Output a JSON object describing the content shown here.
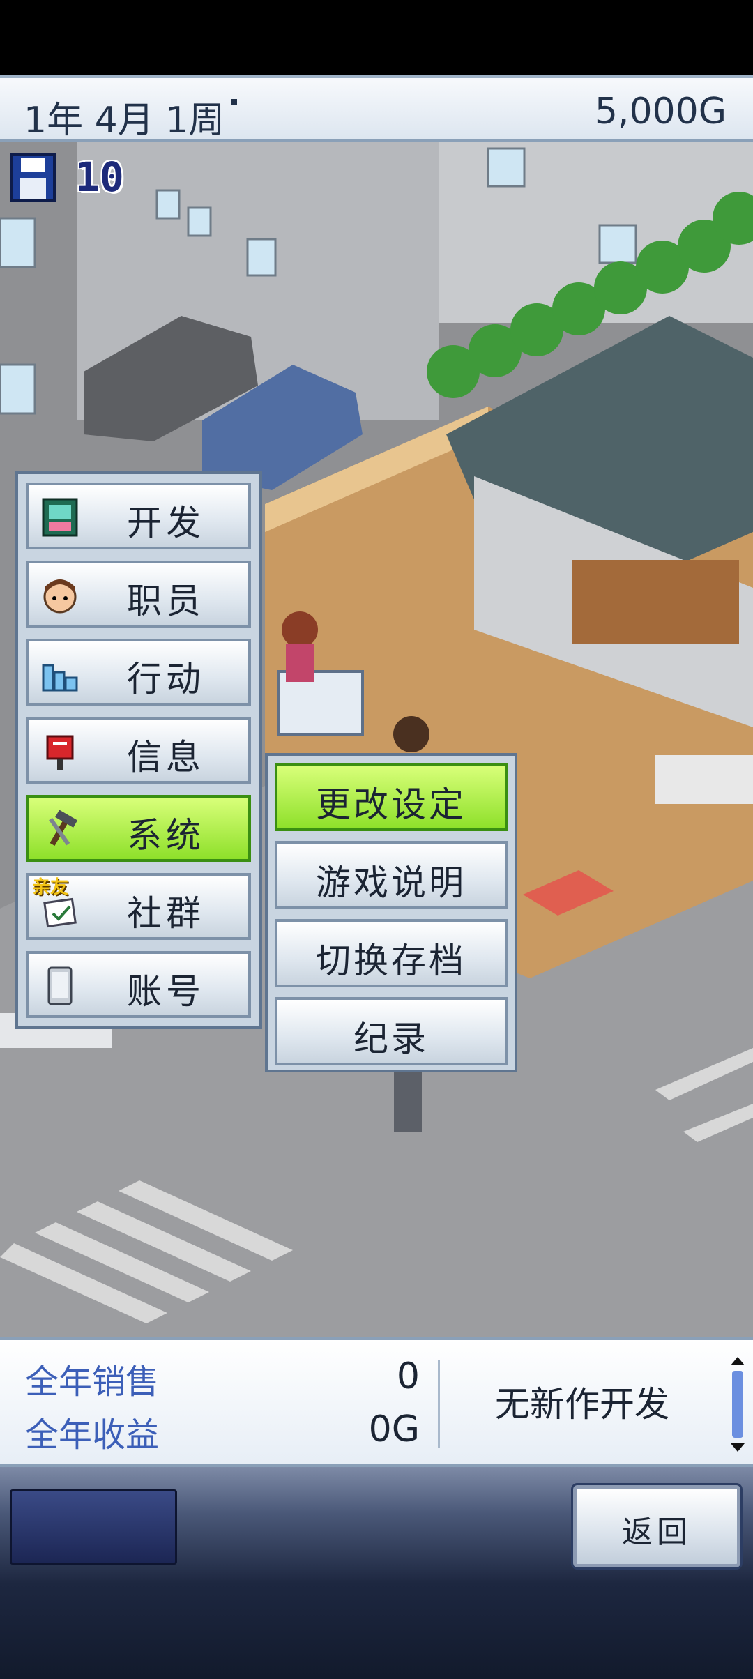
{
  "status_bar": {
    "date": "1年 4月 1周",
    "money": "5,000G"
  },
  "save": {
    "icon": "floppy-disk-icon",
    "count": "10"
  },
  "main_menu": {
    "items": [
      {
        "label": "开发",
        "icon": "develop-icon"
      },
      {
        "label": "职员",
        "icon": "staff-icon"
      },
      {
        "label": "行动",
        "icon": "action-icon"
      },
      {
        "label": "信息",
        "icon": "mailbox-icon"
      },
      {
        "label": "系统",
        "icon": "tools-icon"
      },
      {
        "label": "社群",
        "icon": "community-icon",
        "badge": "亲友"
      },
      {
        "label": "账号",
        "icon": "phone-icon"
      }
    ],
    "selected": "系统"
  },
  "sub_menu": {
    "items": [
      {
        "label": "更改设定"
      },
      {
        "label": "游戏说明"
      },
      {
        "label": "切换存档"
      },
      {
        "label": "纪录"
      }
    ],
    "selected": "更改设定"
  },
  "info_panel": {
    "annual_sales_label": "全年销售",
    "annual_sales_value": "0",
    "annual_revenue_label": "全年收益",
    "annual_revenue_value": "0G",
    "status": "无新作开发"
  },
  "bottom_bar": {
    "back_label": "返回"
  },
  "colors": {
    "menu_active": "#8ee02a",
    "info_label": "#3c5fb8",
    "text_dark": "#1b2433"
  }
}
